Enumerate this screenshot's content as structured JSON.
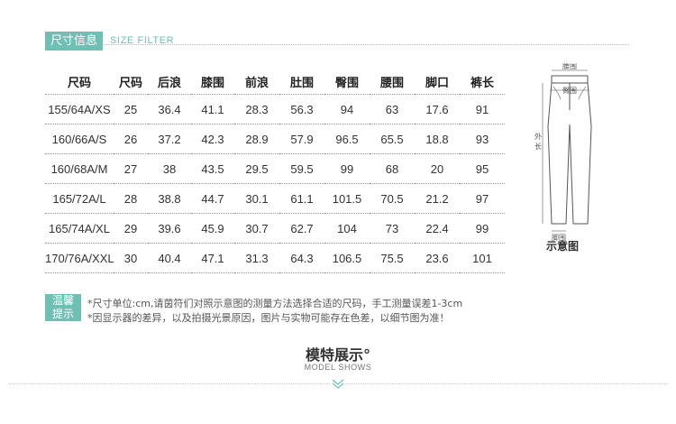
{
  "header": {
    "tag": "尺寸信息",
    "subtitle": "SIZE FILTER"
  },
  "size_table": {
    "columns": [
      "尺码",
      "尺码",
      "后浪",
      "膝围",
      "前浪",
      "肚围",
      "臀围",
      "腰围",
      "脚口",
      "裤长"
    ],
    "rows": [
      [
        "155/64A/XS",
        "25",
        "36.4",
        "41.1",
        "28.3",
        "56.3",
        "94",
        "63",
        "17.6",
        "91"
      ],
      [
        "160/66A/S",
        "26",
        "37.2",
        "42.3",
        "28.9",
        "57.9",
        "96.5",
        "65.5",
        "18.8",
        "93"
      ],
      [
        "160/68A/M",
        "27",
        "38",
        "43.5",
        "29.5",
        "59.5",
        "99",
        "68",
        "20",
        "95"
      ],
      [
        "165/72A/L",
        "28",
        "38.8",
        "44.7",
        "30.1",
        "61.1",
        "101.5",
        "70.5",
        "21.2",
        "97"
      ],
      [
        "165/74A/XL",
        "29",
        "39.6",
        "45.9",
        "30.7",
        "62.7",
        "104",
        "73",
        "22.4",
        "99"
      ],
      [
        "170/76A/XXL",
        "30",
        "40.4",
        "47.1",
        "31.3",
        "64.3",
        "106.5",
        "75.5",
        "23.6",
        "101"
      ]
    ]
  },
  "diagram": {
    "caption": "示意图",
    "labels": {
      "waist": "腰围",
      "hip": "臀围",
      "outseam_1": "外",
      "outseam_2": "长",
      "hem": "脚围"
    }
  },
  "tips": {
    "label_1": "温馨",
    "label_2": "提示",
    "line_1": "*尺寸单位:cm,请茵符们对照示意图的测量方法选择合适的尺码，手工测量误差1-3cm",
    "line_2": "*因显示器的差异，以及拍摄光景原因，图片与实物可能存在色差，以细节图为准！"
  },
  "model": {
    "title": "模特展示°",
    "subtitle": "MODEL SHOWS"
  },
  "colors": {
    "accent": "#6fc0b4",
    "text": "#333333",
    "rule": "#9a9a9a"
  }
}
